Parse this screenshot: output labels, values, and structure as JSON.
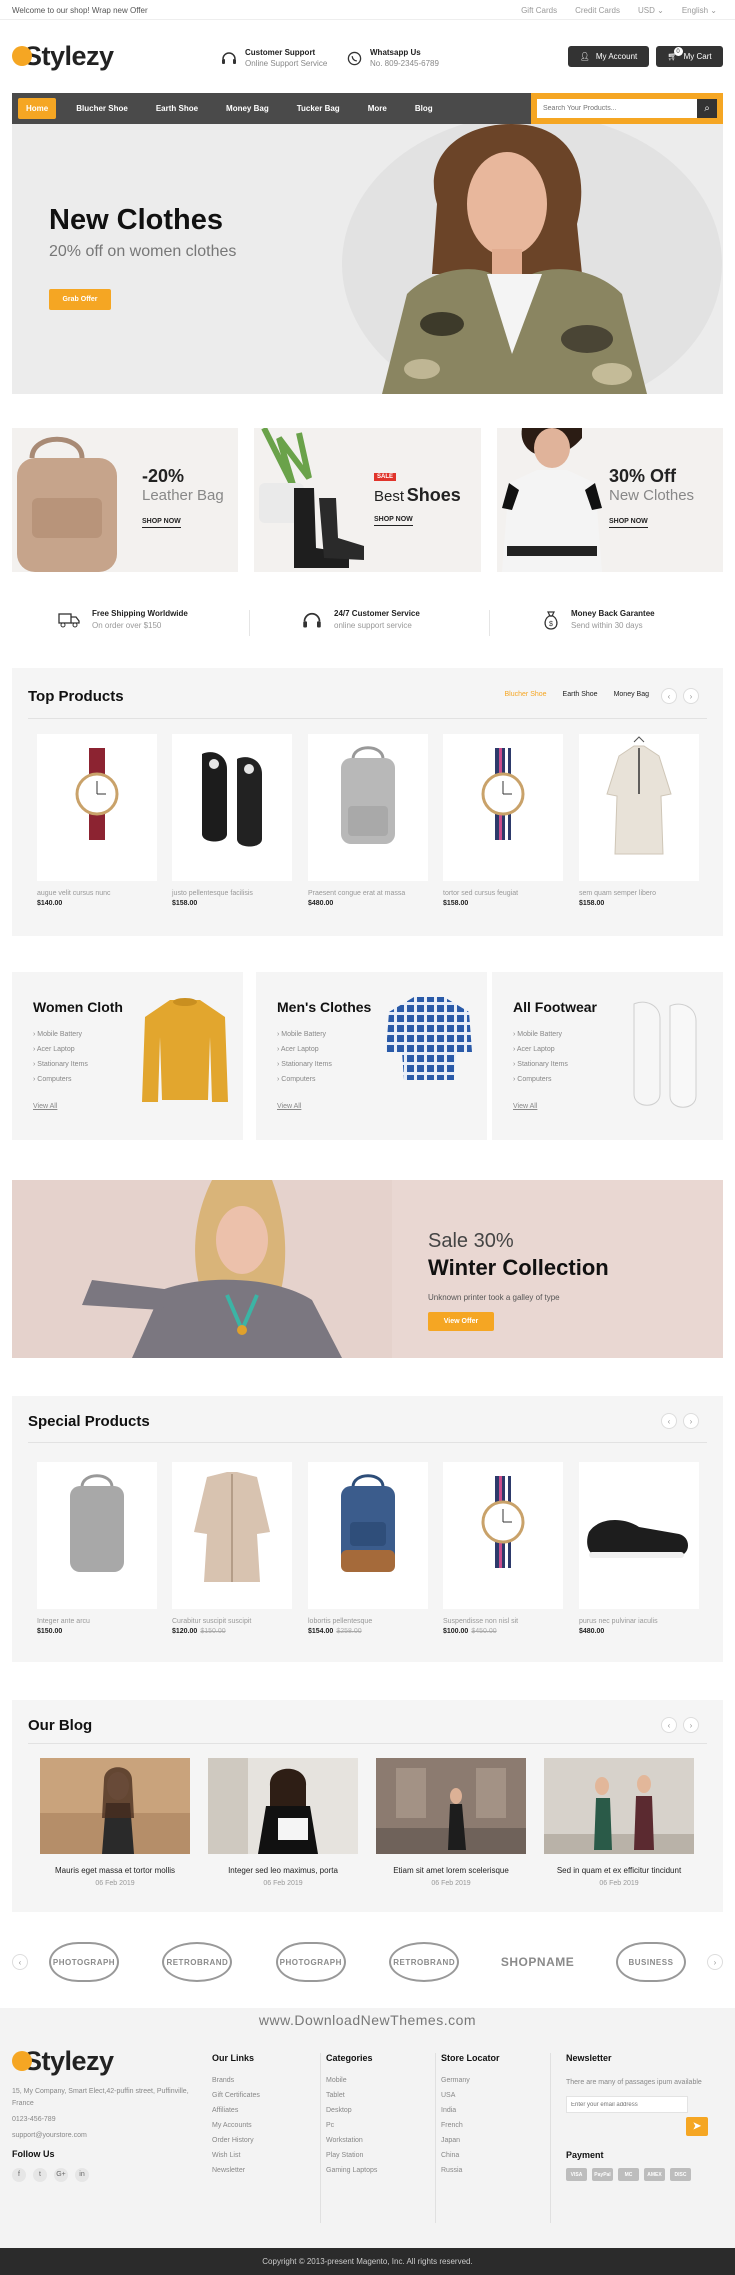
{
  "topbar": {
    "welcome": "Welcome to our shop! Wrap new Offer",
    "links": [
      "Gift Cards",
      "Credit Cards",
      "USD",
      "English"
    ]
  },
  "header": {
    "logo": "Stylezy",
    "support_title": "Customer Support",
    "support_sub": "Online Support Service",
    "whatsapp_title": "Whatsapp Us",
    "whatsapp_sub": "No. 809-2345-6789",
    "account_label": "My Account",
    "cart_label": "My Cart",
    "cart_count": "0"
  },
  "nav": {
    "items": [
      "Home",
      "Blucher Shoe",
      "Earth Shoe",
      "Money Bag",
      "Tucker Bag",
      "More",
      "Blog"
    ],
    "search_placeholder": "Search Your Products..."
  },
  "hero": {
    "title": "New Clothes",
    "subtitle": "20% off on women clothes",
    "button": "Grab Offer"
  },
  "promos": [
    {
      "big": "-20%",
      "small": "Leather Bag",
      "shop": "SHOP NOW"
    },
    {
      "badge": "SALE",
      "small": "Best",
      "big": "Shoes",
      "shop": "SHOP NOW"
    },
    {
      "big": "30% Off",
      "small": "New Clothes",
      "shop": "SHOP NOW"
    }
  ],
  "features": [
    {
      "title": "Free Shipping Worldwide",
      "sub": "On order over $150"
    },
    {
      "title": "24/7 Customer Service",
      "sub": "online support service"
    },
    {
      "title": "Money Back Garantee",
      "sub": "Send within 30 days"
    }
  ],
  "top_products": {
    "title": "Top Products",
    "tabs": [
      "Blucher Shoe",
      "Earth Shoe",
      "Money Bag"
    ],
    "items": [
      {
        "name": "augue velit cursus nunc",
        "price": "$140.00"
      },
      {
        "name": "justo pellentesque facilisis",
        "price": "$158.00"
      },
      {
        "name": "Praesent congue erat at massa",
        "price": "$480.00"
      },
      {
        "name": "tortor sed cursus feugiat",
        "price": "$158.00"
      },
      {
        "name": "sem quam semper libero",
        "price": "$158.00"
      }
    ]
  },
  "categories": [
    {
      "title": "Women Cloth",
      "links": [
        "Mobile Battery",
        "Acer Laptop",
        "Stationary Items",
        "Computers"
      ],
      "view": "View All"
    },
    {
      "title": "Men's Clothes",
      "links": [
        "Mobile Battery",
        "Acer Laptop",
        "Stationary Items",
        "Computers"
      ],
      "view": "View All"
    },
    {
      "title": "All Footwear",
      "links": [
        "Mobile Battery",
        "Acer Laptop",
        "Stationary Items",
        "Computers"
      ],
      "view": "View All"
    }
  ],
  "banner2": {
    "line1": "Sale 30%",
    "line2": "Winter Collection",
    "sub": "Unknown printer took a galley of type",
    "button": "View Offer"
  },
  "special_products": {
    "title": "Special Products",
    "items": [
      {
        "name": "Integer ante arcu",
        "price": "$150.00",
        "old": ""
      },
      {
        "name": "Curabitur suscipit suscipit",
        "price": "$120.00",
        "old": "$150.00"
      },
      {
        "name": "lobortis pellentesque",
        "price": "$154.00",
        "old": "$258.00"
      },
      {
        "name": "Suspendisse non nisl sit",
        "price": "$100.00",
        "old": "$450.00"
      },
      {
        "name": "purus nec pulvinar iaculis",
        "price": "$480.00",
        "old": ""
      }
    ]
  },
  "blog": {
    "title": "Our Blog",
    "posts": [
      {
        "title": "Mauris eget massa et tortor mollis",
        "date": "06 Feb 2019"
      },
      {
        "title": "Integer sed leo maximus, porta",
        "date": "06 Feb 2019"
      },
      {
        "title": "Etiam sit amet lorem scelerisque",
        "date": "06 Feb 2019"
      },
      {
        "title": "Sed in quam et ex efficitur tincidunt",
        "date": "06 Feb 2019"
      }
    ]
  },
  "brands": [
    "PHOTOGRAPH",
    "RETROBRAND",
    "PHOTOGRAPH",
    "RETROBRAND",
    "SHOPNAME",
    "BUSINESS"
  ],
  "watermark": "www.DownloadNewThemes.com",
  "footer": {
    "logo": "Stylezy",
    "address": "15, My Company, Smart Elect,42-puffin street, Puffinville, France",
    "phone": "0123-456-789",
    "email": "support@yourstore.com",
    "follow_title": "Follow Us",
    "social": [
      "f",
      "t",
      "G+",
      "in"
    ],
    "our_links_title": "Our Links",
    "our_links": [
      "Brands",
      "Gift Certificates",
      "Affiliates",
      "My Accounts",
      "Order History",
      "Wish List",
      "Newsletter"
    ],
    "categories_title": "Categories",
    "categories": [
      "Mobile",
      "Tablet",
      "Desktop",
      "Pc",
      "Workstation",
      "Play Station",
      "Gaming Laptops"
    ],
    "store_title": "Store Locator",
    "stores": [
      "Germany",
      "USA",
      "India",
      "French",
      "Japan",
      "China",
      "Russia"
    ],
    "newsletter_title": "Newsletter",
    "newsletter_text": "There are many of passages ipum available",
    "newsletter_placeholder": "Enter your email address",
    "payment_title": "Payment",
    "payments": [
      "VISA",
      "PayPal",
      "MC",
      "AMEX",
      "DISC"
    ]
  },
  "copyright": "Copyright © 2013-present Magento, Inc. All rights reserved.",
  "colors": {
    "accent": "#f5a623",
    "nav": "#4a4a4a",
    "dark": "#2b2b2b"
  }
}
